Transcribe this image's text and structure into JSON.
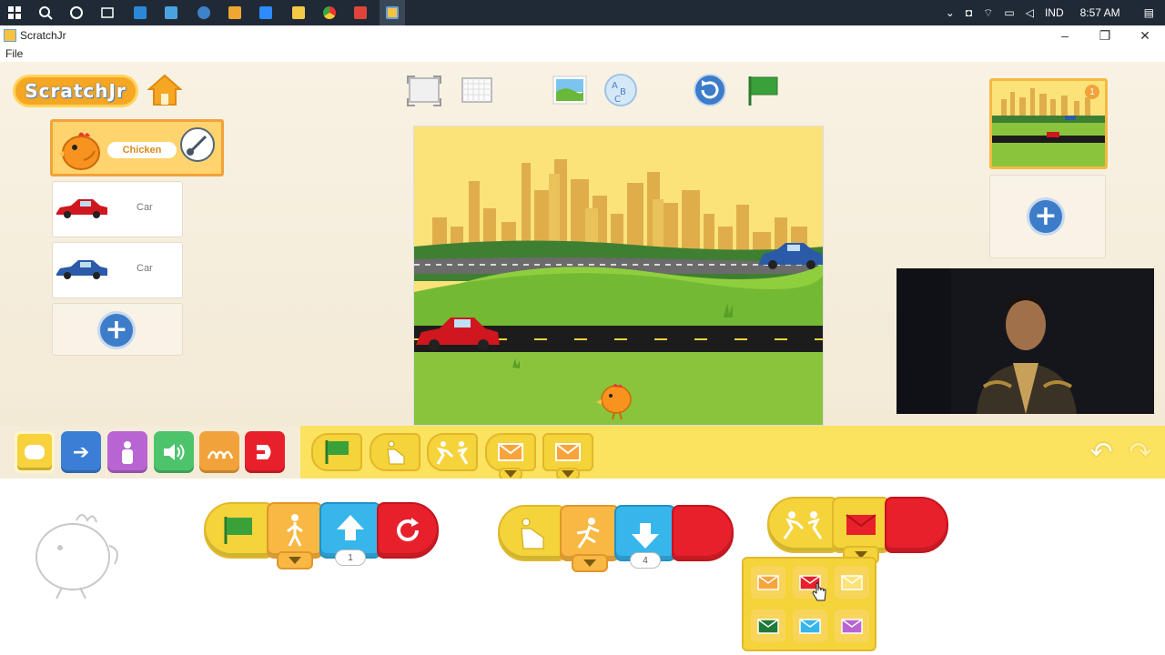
{
  "taskbar": {
    "language": "IND",
    "time": "8:57 AM"
  },
  "window": {
    "title": "ScratchJr",
    "menu": [
      "File"
    ]
  },
  "app": {
    "logo_text": "ScratchJr",
    "sprites": [
      {
        "name": "Chicken",
        "selected": true
      },
      {
        "name": "Car",
        "selected": false
      },
      {
        "name": "Car",
        "selected": false
      }
    ],
    "page_number": "1"
  },
  "categories": [
    {
      "name": "triggering",
      "color": "#f7d23c"
    },
    {
      "name": "motion",
      "color": "#3a7fd5"
    },
    {
      "name": "looks",
      "color": "#b865d3"
    },
    {
      "name": "sound",
      "color": "#4dc46c"
    },
    {
      "name": "control",
      "color": "#f2a23a"
    },
    {
      "name": "end",
      "color": "#e8202b"
    }
  ],
  "palette_blocks": [
    "start-on-green-flag",
    "start-on-tap",
    "start-on-bump",
    "start-on-message",
    "send-message"
  ],
  "scripts": {
    "script1": {
      "move_up_value": "1"
    },
    "script2": {
      "move_down_value": "4"
    }
  },
  "colors": {
    "palette_bg": "#fbe25f",
    "paper_bg": "#f6efdf",
    "accent": "#f2a23a"
  }
}
